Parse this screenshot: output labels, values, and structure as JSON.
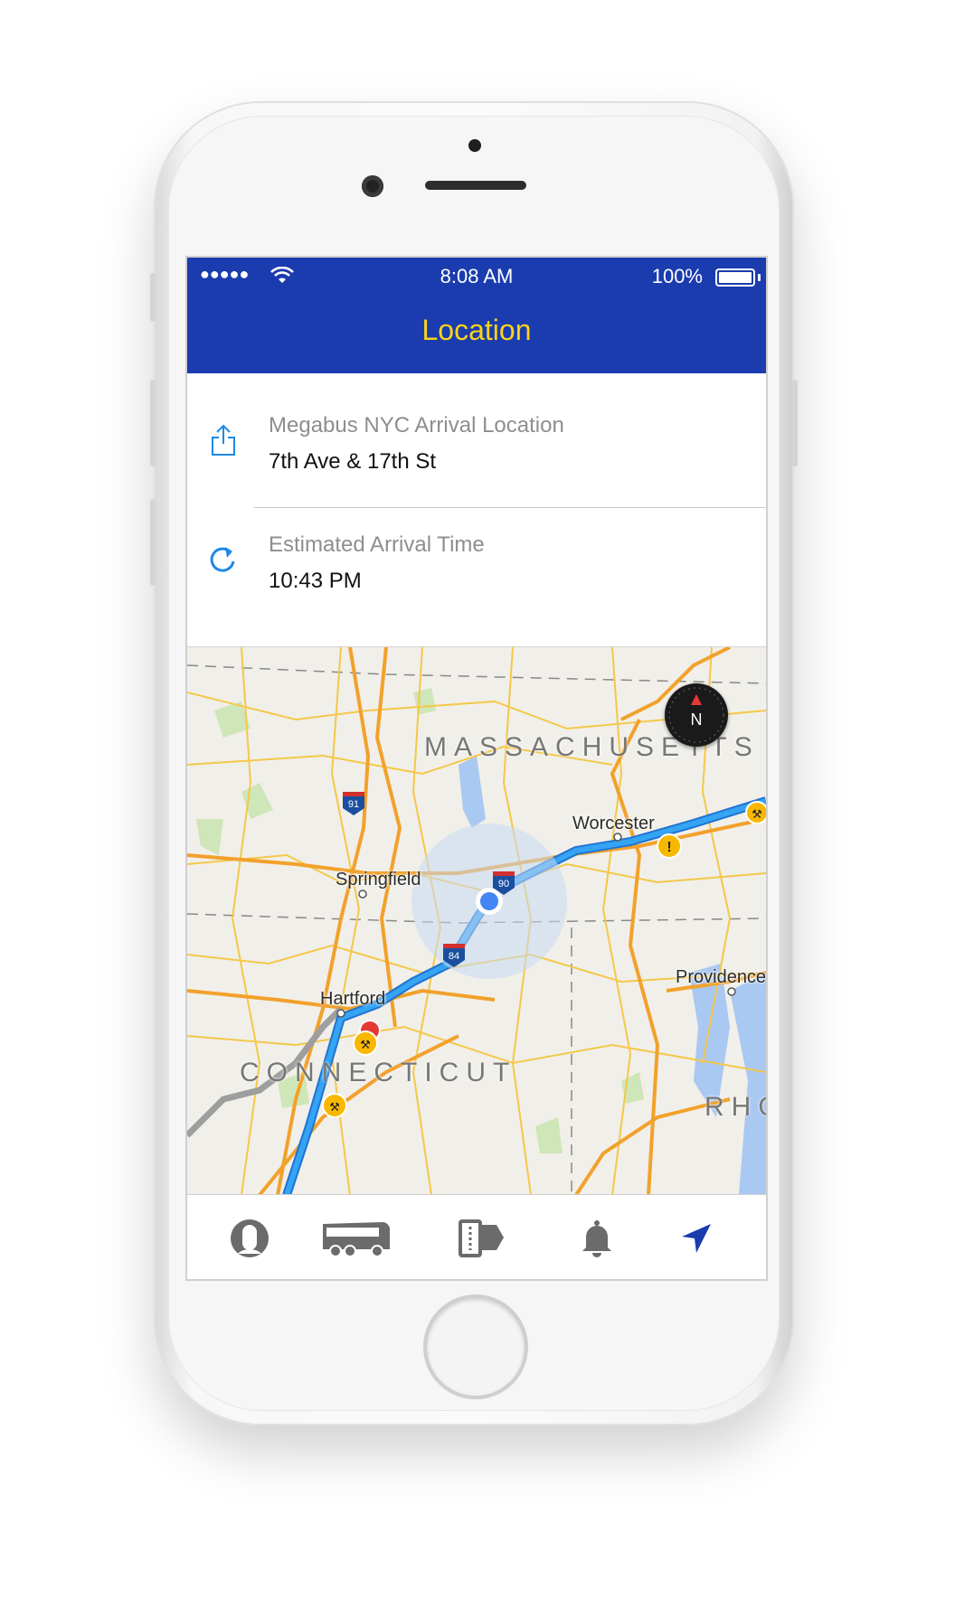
{
  "status_bar": {
    "signal": "●●●●●",
    "time": "8:08 AM",
    "battery": "100%"
  },
  "nav": {
    "title": "Location"
  },
  "arrival_location": {
    "label": "Megabus NYC Arrival Location",
    "value": "7th Ave & 17th St",
    "icon": "share-icon"
  },
  "arrival_time": {
    "label": "Estimated Arrival Time",
    "value": "10:43 PM",
    "icon": "refresh-icon"
  },
  "map": {
    "states": [
      "MASSACHUSETTS",
      "CONNECTICUT",
      "RHO"
    ],
    "cities": [
      "Worcester",
      "Springfield",
      "Hartford",
      "Providence"
    ],
    "highways": [
      "91",
      "84",
      "90"
    ],
    "compass": "N"
  },
  "tabs": [
    {
      "name": "profile",
      "icon": "profile-icon"
    },
    {
      "name": "bus",
      "icon": "bus-icon"
    },
    {
      "name": "tickets",
      "icon": "ticket-icon"
    },
    {
      "name": "alerts",
      "icon": "bell-icon"
    },
    {
      "name": "location",
      "icon": "location-arrow-icon",
      "active": true
    }
  ],
  "colors": {
    "nav_bg": "#1b3cae",
    "title": "#f7d31c",
    "accent": "#1e88e5",
    "route": "#2196f3",
    "active_tab": "#1b3cae"
  }
}
